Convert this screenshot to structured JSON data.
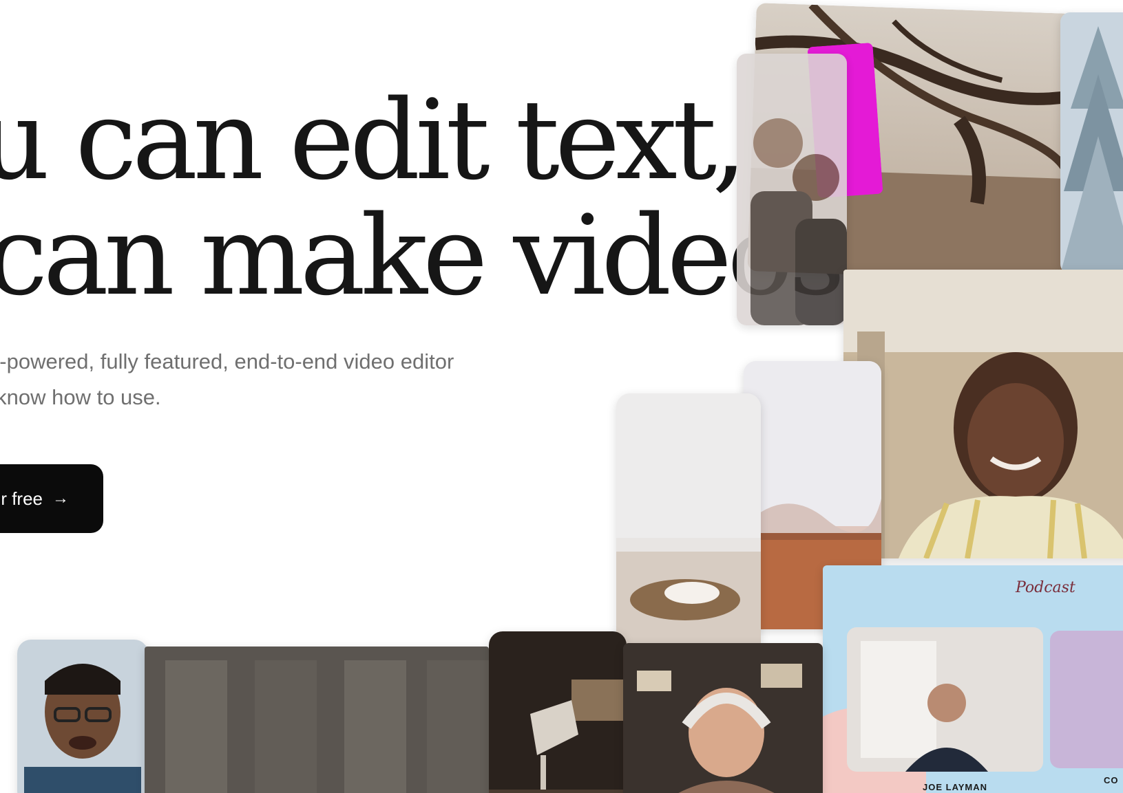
{
  "hero": {
    "headline_line1": "ou can edit text,",
    "headline_line2": "u can make videos.",
    "subhead_line1": "AI-powered, fully featured, end-to-end video editor",
    "subhead_line2": "y know how to use.",
    "cta_label": "r free",
    "cta_icon": "arrow-right-icon"
  },
  "collage": {
    "podcast_caption": "JOE LAYMAN",
    "podcast_logo_text": "Podcast",
    "corner_caption": "CO"
  },
  "colors": {
    "headline": "#161616",
    "subhead": "#6f6f6f",
    "cta_background": "#0b0b0b",
    "cta_text": "#ffffff",
    "accent_magenta": "#e41ad6",
    "podcast_bg": "#b9dcef"
  }
}
